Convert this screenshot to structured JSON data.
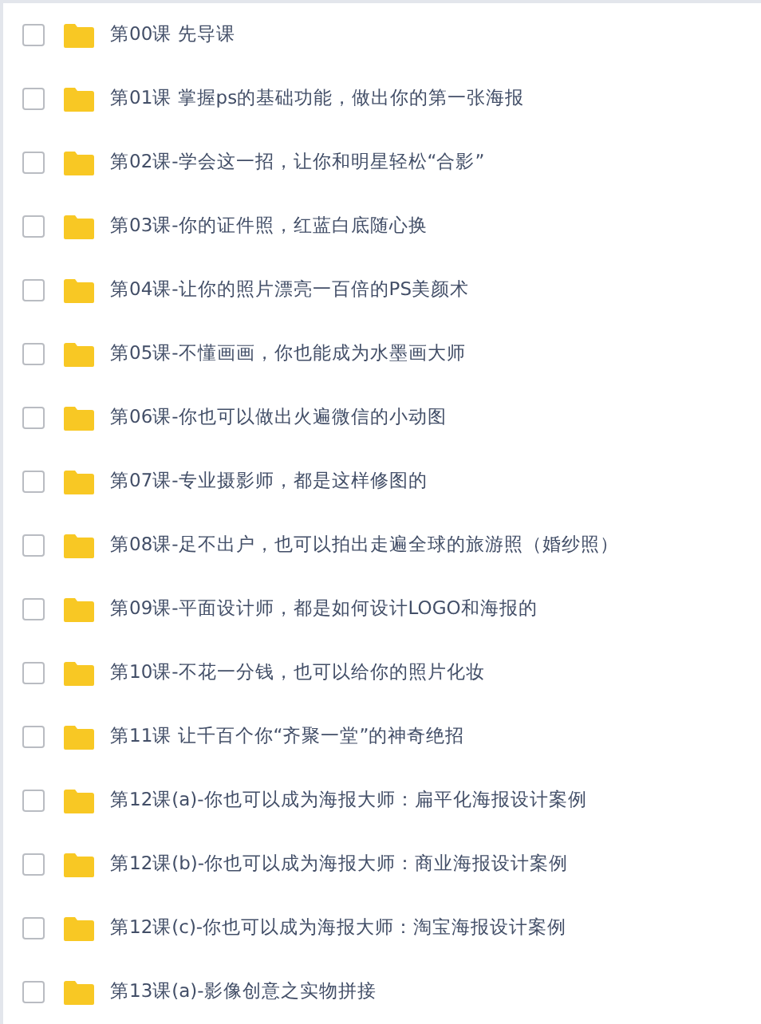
{
  "files": [
    {
      "name": "第00课 先导课",
      "checked": false
    },
    {
      "name": "第01课 掌握ps的基础功能，做出你的第一张海报",
      "checked": false
    },
    {
      "name": "第02课-学会这一招，让你和明星轻松“合影”",
      "checked": false
    },
    {
      "name": "第03课-你的证件照，红蓝白底随心换",
      "checked": false
    },
    {
      "name": "第04课-让你的照片漂亮一百倍的PS美颜术",
      "checked": false
    },
    {
      "name": "第05课-不懂画画，你也能成为水墨画大师",
      "checked": false
    },
    {
      "name": "第06课-你也可以做出火遍微信的小动图",
      "checked": false
    },
    {
      "name": "第07课-专业摄影师，都是这样修图的",
      "checked": false
    },
    {
      "name": "第08课-足不出户，也可以拍出走遍全球的旅游照（婚纱照）",
      "checked": false
    },
    {
      "name": "第09课-平面设计师，都是如何设计LOGO和海报的",
      "checked": false
    },
    {
      "name": "第10课-不花一分钱，也可以给你的照片化妆",
      "checked": false
    },
    {
      "name": "第11课 让千百个你“齐聚一堂”的神奇绝招",
      "checked": false
    },
    {
      "name": "第12课(a)-你也可以成为海报大师：扁平化海报设计案例",
      "checked": false
    },
    {
      "name": "第12课(b)-你也可以成为海报大师：商业海报设计案例",
      "checked": false
    },
    {
      "name": "第12课(c)-你也可以成为海报大师：淘宝海报设计案例",
      "checked": false
    },
    {
      "name": "第13课(a)-影像创意之实物拼接",
      "checked": false
    }
  ]
}
